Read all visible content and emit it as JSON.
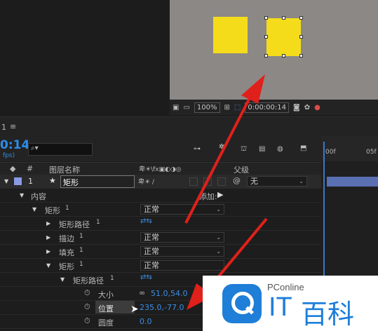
{
  "viewer": {
    "zoom": "100%",
    "timecode": "0:00:00:14"
  },
  "panel": {
    "tab_number": "1",
    "tab_menu": "≡"
  },
  "timeline": {
    "current_time": "0:14",
    "fps_label": "fps)",
    "search_placeholder": "",
    "ruler_labels": [
      "00f",
      "05f"
    ]
  },
  "columns": {
    "number": "#",
    "layer_name": "图层名称",
    "parent": "父级"
  },
  "layer": {
    "index": "1",
    "name": "矩形",
    "parent_value": "无",
    "add_label": "添加:"
  },
  "tree": [
    {
      "label": "内容",
      "suffix": "",
      "expanded": true,
      "indent": 0,
      "mode": ""
    },
    {
      "label": "矩形",
      "suffix": "1",
      "expanded": true,
      "indent": 1,
      "mode": "正常"
    },
    {
      "label": "矩形路径",
      "suffix": "1",
      "expanded": false,
      "indent": 2,
      "mode": ""
    },
    {
      "label": "描边",
      "suffix": "1",
      "expanded": false,
      "indent": 2,
      "mode": "正常"
    },
    {
      "label": "填充",
      "suffix": "1",
      "expanded": false,
      "indent": 2,
      "mode": "正常"
    },
    {
      "label": "矩形",
      "suffix": "1",
      "expanded": true,
      "indent": 2,
      "mode": "正常"
    },
    {
      "label": "矩形路径",
      "suffix": "1",
      "expanded": true,
      "indent": 3,
      "mode": ""
    }
  ],
  "properties": [
    {
      "label": "大小",
      "value": "51.0,54.0"
    },
    {
      "label": "位置",
      "value": "235.0,-77.0"
    },
    {
      "label": "圆度",
      "value": "0.0"
    }
  ],
  "watermark": {
    "top": "PConline",
    "brand_it": "IT",
    "brand_cn": "百科"
  },
  "colors": {
    "accent_blue": "#2d8ceb",
    "shape_yellow": "#f5dc1a",
    "arrow_red": "#e0201a",
    "layer_label": "#5b6fb3"
  }
}
